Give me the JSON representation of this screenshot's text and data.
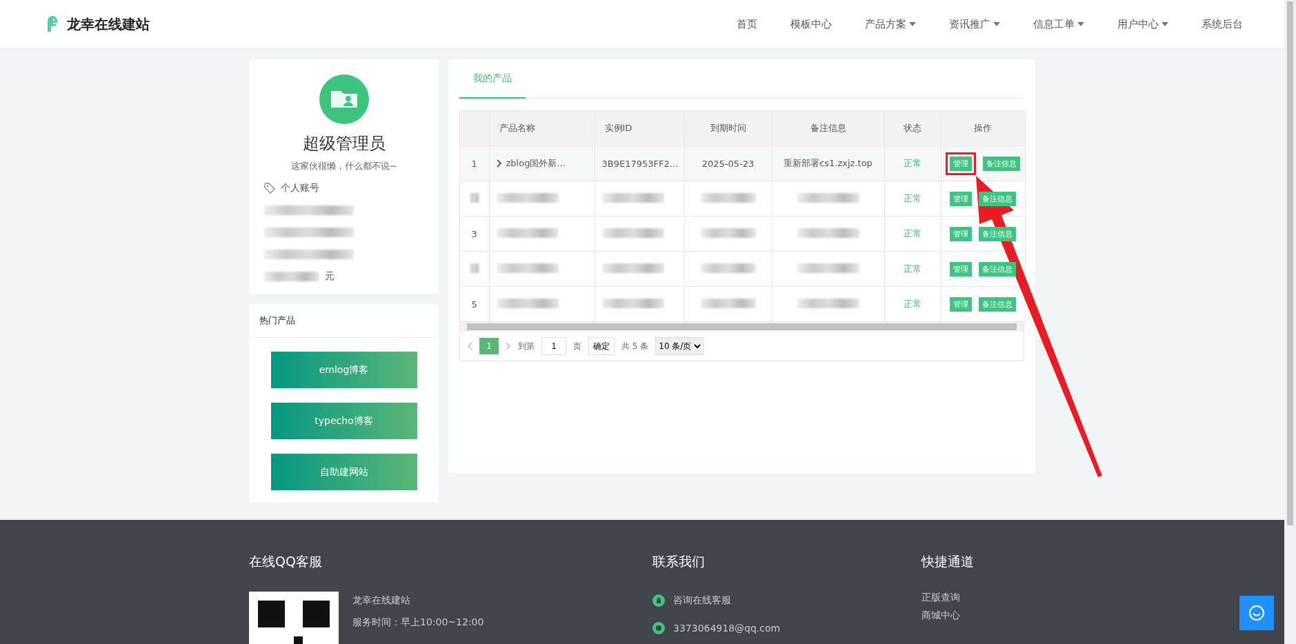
{
  "header": {
    "brand": "龙幸在线建站",
    "nav": [
      {
        "label": "首页",
        "has_menu": false
      },
      {
        "label": "模板中心",
        "has_menu": false
      },
      {
        "label": "产品方案",
        "has_menu": true
      },
      {
        "label": "资讯推广",
        "has_menu": true
      },
      {
        "label": "信息工单",
        "has_menu": true
      },
      {
        "label": "用户中心",
        "has_menu": true
      },
      {
        "label": "系统后台",
        "has_menu": false
      }
    ]
  },
  "profile": {
    "name": "超级管理员",
    "bio": "这家伙很懒，什么都不说~",
    "info": [
      {
        "kind": "text",
        "text": "个人账号"
      },
      {
        "kind": "blurred"
      },
      {
        "kind": "blurred"
      },
      {
        "kind": "blurred"
      },
      {
        "kind": "blurred",
        "suffix": "元"
      }
    ]
  },
  "hot_products": {
    "title": "热门产品",
    "items": [
      "emlog博客",
      "typecho博客",
      "自助建网站"
    ]
  },
  "products": {
    "tabs": [
      {
        "label": "我的产品",
        "selected": true
      }
    ],
    "columns": [
      "",
      "产品名称",
      "实例ID",
      "到期时间",
      "备注信息",
      "状态",
      "操作"
    ],
    "rows": [
      {
        "cells": [
          {
            "kind": "text",
            "text": "1"
          },
          {
            "kind": "expand",
            "text": "zblog国外新..."
          },
          {
            "kind": "text",
            "text": "3B9E17953FF2..."
          },
          {
            "kind": "text",
            "text": "2025-05-23"
          },
          {
            "kind": "text",
            "text": "重新部署cs1.zxjz.top"
          }
        ],
        "status": "正常",
        "actions": [
          "管理",
          "备注信息"
        ],
        "highlighted": true
      },
      {
        "cells": [
          {
            "kind": "blurred"
          },
          {
            "kind": "blurred"
          },
          {
            "kind": "blurred"
          },
          {
            "kind": "blurred"
          },
          {
            "kind": "blurred"
          }
        ],
        "status": "正常",
        "actions": [
          "管理",
          "备注信息"
        ],
        "highlighted": false
      },
      {
        "cells": [
          {
            "kind": "text",
            "text": "3"
          },
          {
            "kind": "blurred"
          },
          {
            "kind": "blurred"
          },
          {
            "kind": "blurred"
          },
          {
            "kind": "blurred"
          }
        ],
        "status": "正常",
        "actions": [
          "管理",
          "备注信息"
        ],
        "highlighted": false
      },
      {
        "cells": [
          {
            "kind": "blurred"
          },
          {
            "kind": "blurred"
          },
          {
            "kind": "blurred"
          },
          {
            "kind": "blurred"
          },
          {
            "kind": "blurred"
          }
        ],
        "status": "正常",
        "actions": [
          "管理",
          "备注信息"
        ],
        "highlighted": false
      },
      {
        "cells": [
          {
            "kind": "text",
            "text": "5"
          },
          {
            "kind": "blurred"
          },
          {
            "kind": "blurred"
          },
          {
            "kind": "blurred"
          },
          {
            "kind": "blurred"
          }
        ],
        "status": "正常",
        "actions": [
          "管理",
          "备注信息"
        ],
        "highlighted": false
      }
    ],
    "pagination": {
      "pages": [
        {
          "label": "1",
          "selected": true
        }
      ],
      "goto_label": "到第",
      "goto_value": "1",
      "page_unit": "页",
      "confirm": "确定",
      "total": "共 5 条",
      "page_size": "10 条/页"
    }
  },
  "footer": {
    "columns": [
      {
        "kind": "service",
        "title": "在线QQ客服",
        "lines": [
          "龙幸在线建站",
          "服务时间：早上10:00~12:00"
        ]
      },
      {
        "kind": "contact",
        "title": "联系我们",
        "lines": [
          "咨询在线客服",
          "3373064918@qq.com"
        ]
      },
      {
        "kind": "links",
        "title": "快捷通道",
        "lines": [
          "正版查询",
          "商城中心"
        ]
      }
    ]
  }
}
